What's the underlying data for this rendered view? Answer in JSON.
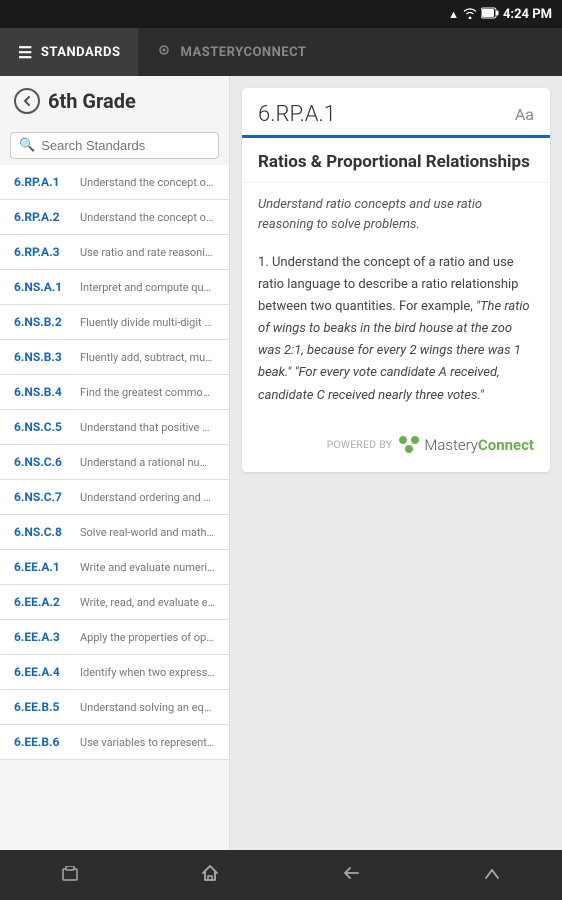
{
  "statusBar": {
    "time": "4:24 PM",
    "icons": [
      "battery",
      "signal",
      "wifi"
    ]
  },
  "navBar": {
    "tabs": [
      {
        "id": "standards",
        "label": "STANDARDS",
        "icon": "≡",
        "active": true
      },
      {
        "id": "masteryconnect",
        "label": "MASTERYCONNECT",
        "icon": "⬡",
        "active": false
      }
    ]
  },
  "leftPanel": {
    "gradeTitle": "6th Grade",
    "searchPlaceholder": "Search Standards",
    "standards": [
      {
        "code": "6.RP.A.1",
        "desc": "Understand the concept of a ratio..."
      },
      {
        "code": "6.RP.A.2",
        "desc": "Understand the concept of a unit..."
      },
      {
        "code": "6.RP.A.3",
        "desc": "Use ratio and rate reasoning to so..."
      },
      {
        "code": "6.NS.A.1",
        "desc": "Interpret and compute quotients..."
      },
      {
        "code": "6.NS.B.2",
        "desc": "Fluently divide multi-digit number..."
      },
      {
        "code": "6.NS.B.3",
        "desc": "Fluently add, subtract, multiply, a..."
      },
      {
        "code": "6.NS.B.4",
        "desc": "Find the greatest common factor..."
      },
      {
        "code": "6.NS.C.5",
        "desc": "Understand that positive and neg..."
      },
      {
        "code": "6.NS.C.6",
        "desc": "Understand a rational number as..."
      },
      {
        "code": "6.NS.C.7",
        "desc": "Understand ordering and absolut..."
      },
      {
        "code": "6.NS.C.8",
        "desc": "Solve real-world and mathematica..."
      },
      {
        "code": "6.EE.A.1",
        "desc": "Write and evaluate numerical expr..."
      },
      {
        "code": "6.EE.A.2",
        "desc": "Write, read, and evaluate expressi..."
      },
      {
        "code": "6.EE.A.3",
        "desc": "Apply the properties of operations..."
      },
      {
        "code": "6.EE.A.4",
        "desc": "Identify when two expressions are..."
      },
      {
        "code": "6.EE.B.5",
        "desc": "Understand solving an equation o..."
      },
      {
        "code": "6.EE.B.6",
        "desc": "Use variables to represent numbe..."
      }
    ]
  },
  "rightPanel": {
    "standardCode": "6.RP.A.1",
    "fontSizeLabel": "Aa",
    "category": "Ratios & Proportional Relationships",
    "subtitle": "Understand ratio concepts and use ratio reasoning to solve problems.",
    "body": "1. Understand the concept of a ratio and use ratio language to describe a ratio relationship between two quantities. For example, \"The ratio of wings to beaks in the bird house at the zoo was 2:1, because for every 2 wings there was 1 beak.\" \"For every vote candidate A received, candidate C received nearly three votes.\"",
    "poweredBy": "POWERED BY",
    "masteryConnectText": "MasteryConnect"
  },
  "bottomNav": {
    "buttons": [
      "recent",
      "home",
      "back",
      "up"
    ]
  }
}
